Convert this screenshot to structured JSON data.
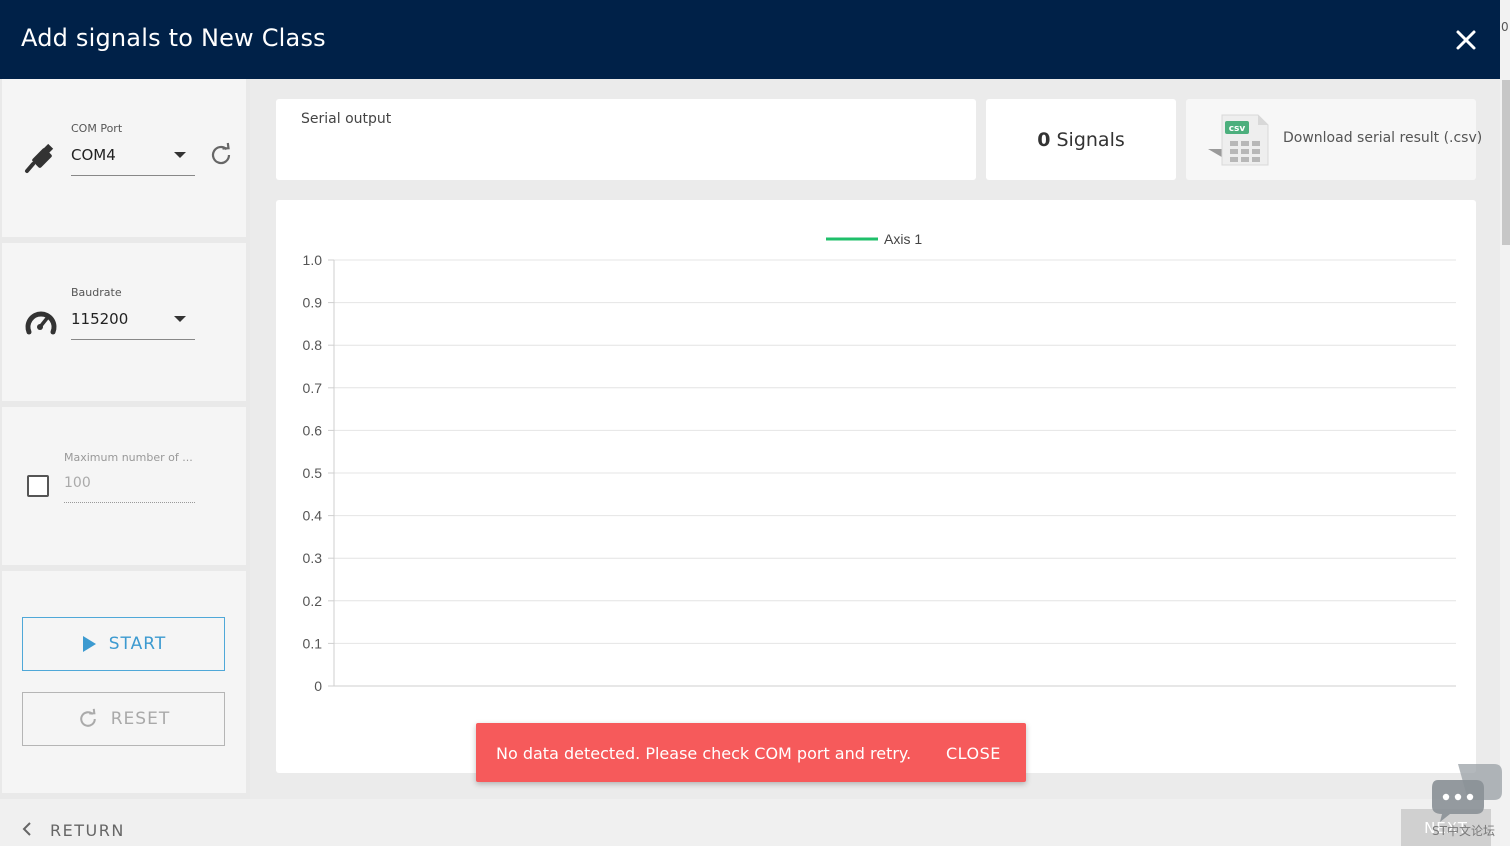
{
  "header": {
    "title": "Add signals to New Class"
  },
  "edge": {
    "zero": "0"
  },
  "com_port": {
    "label": "COM Port",
    "value": "COM4"
  },
  "baudrate": {
    "label": "Baudrate",
    "value": "115200"
  },
  "max_signals": {
    "label": "Maximum number of ...",
    "value": "100",
    "checked": false
  },
  "buttons": {
    "start": "START",
    "reset": "RESET"
  },
  "serial": {
    "label": "Serial output"
  },
  "signals": {
    "count": "0",
    "unit": "Signals"
  },
  "download": {
    "label": "Download serial result (.csv)",
    "badge": "csv"
  },
  "toast": {
    "message": "No data detected. Please check COM port and retry.",
    "close": "CLOSE"
  },
  "footer": {
    "return": "RETURN",
    "next": "NEXT"
  },
  "watermark": {
    "text": "ST中文论坛"
  },
  "colors": {
    "header": "#002148",
    "accent": "#3c9ad0",
    "toast": "#f65a5b",
    "series": "#1fbf6a"
  },
  "chart_data": {
    "type": "line",
    "series": [
      {
        "name": "Axis 1",
        "values": []
      }
    ],
    "x": [],
    "ylim": [
      0,
      1.0
    ],
    "yticks": [
      "1.0",
      "0.9",
      "0.8",
      "0.7",
      "0.6",
      "0.5",
      "0.4",
      "0.3",
      "0.2",
      "0.1",
      "0"
    ],
    "grid": true,
    "legend": "top-center"
  }
}
